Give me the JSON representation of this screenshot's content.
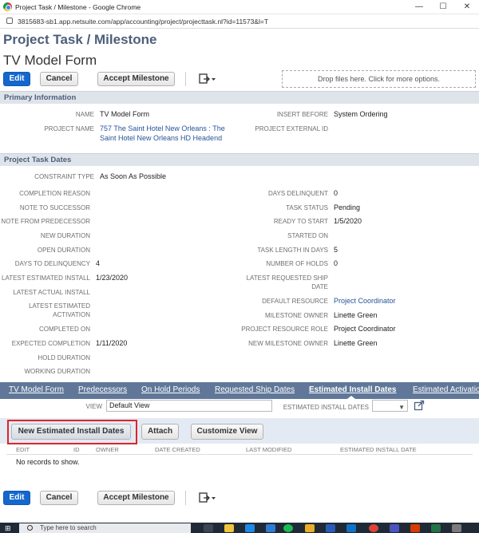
{
  "browser": {
    "window_title": "Project Task / Milestone - Google Chrome",
    "url": "3815683-sb1.app.netsuite.com/app/accounting/project/projecttask.nl?id=11573&l=T",
    "minimize": "—",
    "maximize": "☐",
    "close": "✕"
  },
  "header": {
    "page_title": "Project Task / Milestone",
    "record_name": "TV Model Form",
    "edit_label": "Edit",
    "cancel_label": "Cancel",
    "accept_label": "Accept Milestone",
    "actions_icon": "actions-menu-icon",
    "dropzone_text": "Drop files here. Click for more options."
  },
  "primary_info": {
    "section_title": "Primary Information",
    "name_label": "NAME",
    "name_value": "TV Model Form",
    "project_name_label": "PROJECT NAME",
    "project_name_line1": "757 The Saint Hotel New Orleans : The",
    "project_name_line2": "Saint Hotel New Orleans HD Headend",
    "insert_before_label": "INSERT BEFORE",
    "insert_before_value": "System Ordering",
    "project_external_id_label": "PROJECT EXTERNAL ID"
  },
  "task_dates": {
    "section_title": "Project Task Dates",
    "constraint_type_label": "CONSTRAINT TYPE",
    "constraint_type_value": "As Soon As Possible",
    "completion_reason_label": "COMPLETION REASON",
    "note_to_successor_label": "NOTE TO SUCCESSOR",
    "note_from_predecessor_label": "NOTE FROM PREDECESSOR",
    "new_duration_label": "NEW DURATION",
    "open_duration_label": "OPEN DURATION",
    "days_to_delinquency_label": "DAYS TO DELINQUENCY",
    "days_to_delinquency_value": "4",
    "latest_est_install_label": "LATEST ESTIMATED INSTALL",
    "latest_est_install_value": "1/23/2020",
    "latest_actual_install_label": "LATEST ACTUAL INSTALL",
    "latest_est_activation_label1": "LATEST ESTIMATED",
    "latest_est_activation_label2": "ACTIVATION",
    "completed_on_label": "COMPLETED ON",
    "expected_completion_label": "EXPECTED COMPLETION",
    "expected_completion_value": "1/11/2020",
    "hold_duration_label": "HOLD DURATION",
    "working_duration_label": "WORKING DURATION",
    "days_delinquent_label": "DAYS DELINQUENT",
    "days_delinquent_value": "0",
    "task_status_label": "TASK STATUS",
    "task_status_value": "Pending",
    "ready_to_start_label": "READY TO START",
    "ready_to_start_value": "1/5/2020",
    "started_on_label": "STARTED ON",
    "task_length_label": "TASK LENGTH IN DAYS",
    "task_length_value": "5",
    "number_of_holds_label": "NUMBER OF HOLDS",
    "number_of_holds_value": "0",
    "latest_req_ship_label1": "LATEST REQUESTED SHIP",
    "latest_req_ship_label2": "DATE",
    "default_resource_label": "DEFAULT RESOURCE",
    "default_resource_value": "Project Coordinator",
    "milestone_owner_label": "MILESTONE OWNER",
    "milestone_owner_value": "Linette Green",
    "project_resource_role_label": "PROJECT RESOURCE ROLE",
    "project_resource_role_value": "Project Coordinator",
    "new_milestone_owner_label": "NEW MILESTONE OWNER",
    "new_milestone_owner_value": "Linette Green"
  },
  "sublist": {
    "tabs": [
      "TV Model Form",
      "Predecessors",
      "On Hold Periods",
      "Requested Ship Dates",
      "Estimated Install Dates",
      "Estimated Activatio"
    ],
    "view_label": "VIEW",
    "view_value": "Default View",
    "est_install_dates_label": "ESTIMATED INSTALL DATES",
    "new_button": "New Estimated Install Dates",
    "attach_button": "Attach",
    "customize_button": "Customize View",
    "columns": [
      "EDIT",
      "ID",
      "OWNER",
      "DATE CREATED",
      "LAST MODIFIED",
      "ESTIMATED INSTALL DATE"
    ],
    "empty_text": "No records to show."
  },
  "taskbar": {
    "search_placeholder": "Type here to search"
  },
  "colors": {
    "accent": "#1467cc",
    "title": "#4d5f79",
    "tabbar": "#607799",
    "highlight": "#d9262b"
  }
}
